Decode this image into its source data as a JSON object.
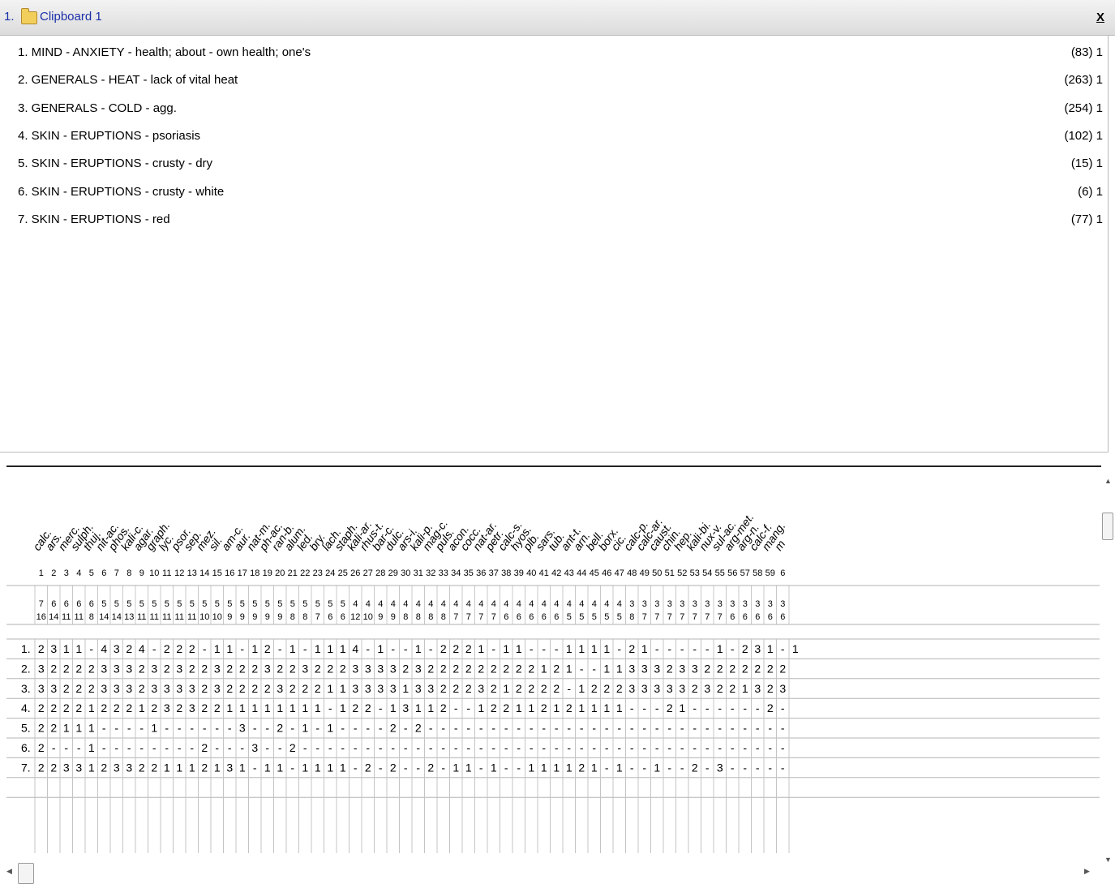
{
  "window": {
    "tab_number": "1.",
    "title": "Clipboard 1",
    "close_label": "X"
  },
  "rubrics": [
    {
      "label": "1. MIND - ANXIETY - health; about - own health; one's",
      "count": "(83) 1"
    },
    {
      "label": "2. GENERALS - HEAT - lack of vital heat",
      "count": "(263) 1"
    },
    {
      "label": "3. GENERALS - COLD - agg.",
      "count": "(254) 1"
    },
    {
      "label": "4. SKIN - ERUPTIONS - psoriasis",
      "count": "(102) 1"
    },
    {
      "label": "5. SKIN - ERUPTIONS - crusty - dry",
      "count": "(15) 1"
    },
    {
      "label": "6. SKIN - ERUPTIONS - crusty - white",
      "count": "(6) 1"
    },
    {
      "label": "7. SKIN - ERUPTIONS - red",
      "count": "(77) 1"
    }
  ],
  "remedies": [
    "calc.",
    "ars.",
    "merc.",
    "sulph.",
    "thuj.",
    "nit-ac.",
    "phos.",
    "kali-c.",
    "agar.",
    "graph.",
    "lyc.",
    "psor.",
    "sep.",
    "mez.",
    "sil.",
    "am-c.",
    "aur.",
    "nat-m.",
    "ph-ac.",
    "ran-b.",
    "alum.",
    "led.",
    "bry.",
    "lach.",
    "staph.",
    "kali-ar.",
    "rhus-t.",
    "bar-c.",
    "dulc.",
    "ars-i.",
    "kali-p.",
    "mag-c.",
    "puls.",
    "acon.",
    "cocc.",
    "nat-ar.",
    "petr.",
    "calc-s.",
    "hyos.",
    "plb.",
    "sars.",
    "tub.",
    "ant-t.",
    "arn.",
    "bell.",
    "borx.",
    "cic.",
    "calc-p.",
    "calc-ar.",
    "caust.",
    "chin.",
    "hep.",
    "kali-bi.",
    "nux-v.",
    "sul-ac.",
    "arg-met.",
    "arg-n.",
    "calc-f.",
    "mang.",
    "m"
  ],
  "column_numbers": [
    "1",
    "2",
    "3",
    "4",
    "5",
    "6",
    "7",
    "8",
    "9",
    "10",
    "11",
    "12",
    "13",
    "14",
    "15",
    "16",
    "17",
    "18",
    "19",
    "20",
    "21",
    "22",
    "23",
    "24",
    "25",
    "26",
    "27",
    "28",
    "29",
    "30",
    "31",
    "32",
    "33",
    "34",
    "35",
    "36",
    "37",
    "38",
    "39",
    "40",
    "41",
    "42",
    "43",
    "44",
    "45",
    "46",
    "47",
    "48",
    "49",
    "50",
    "51",
    "52",
    "53",
    "54",
    "55",
    "56",
    "57",
    "58",
    "59",
    "6"
  ],
  "symptom_counts": [
    "7",
    "6",
    "6",
    "6",
    "6",
    "5",
    "5",
    "5",
    "5",
    "5",
    "5",
    "5",
    "5",
    "5",
    "5",
    "5",
    "5",
    "5",
    "5",
    "5",
    "5",
    "5",
    "5",
    "5",
    "5",
    "4",
    "4",
    "4",
    "4",
    "4",
    "4",
    "4",
    "4",
    "4",
    "4",
    "4",
    "4",
    "4",
    "4",
    "4",
    "4",
    "4",
    "4",
    "4",
    "4",
    "4",
    "4",
    "3",
    "3",
    "3",
    "3",
    "3",
    "3",
    "3",
    "3",
    "3",
    "3",
    "3",
    "3",
    "3"
  ],
  "degree_totals": [
    "16",
    "14",
    "11",
    "11",
    "8",
    "14",
    "14",
    "13",
    "11",
    "11",
    "11",
    "11",
    "11",
    "10",
    "10",
    "9",
    "9",
    "9",
    "9",
    "9",
    "8",
    "8",
    "7",
    "6",
    "6",
    "12",
    "10",
    "9",
    "9",
    "8",
    "8",
    "8",
    "8",
    "7",
    "7",
    "7",
    "7",
    "6",
    "6",
    "6",
    "6",
    "6",
    "5",
    "5",
    "5",
    "5",
    "5",
    "8",
    "7",
    "7",
    "7",
    "7",
    "7",
    "7",
    "7",
    "6",
    "6",
    "6",
    "6",
    "6"
  ],
  "grid_rows": [
    {
      "label": "1.",
      "cells": [
        "2",
        "3",
        "1",
        "1",
        "-",
        "4",
        "3",
        "2",
        "4",
        "-",
        "2",
        "2",
        "2",
        "-",
        "1",
        "1",
        "-",
        "1",
        "2",
        "-",
        "1",
        "-",
        "1",
        "1",
        "1",
        "4",
        "-",
        "1",
        "-",
        "-",
        "1",
        "-",
        "2",
        "2",
        "2",
        "1",
        "-",
        "1",
        "1",
        "-",
        "-",
        "-",
        "1",
        "1",
        "1",
        "1",
        "-",
        "2",
        "1",
        "-",
        "-",
        "-",
        "-",
        "-",
        "1",
        "-",
        "2",
        "3",
        "1",
        "-",
        "1"
      ]
    },
    {
      "label": "2.",
      "cells": [
        "3",
        "2",
        "2",
        "2",
        "2",
        "3",
        "3",
        "3",
        "2",
        "3",
        "2",
        "3",
        "2",
        "2",
        "3",
        "2",
        "2",
        "2",
        "3",
        "2",
        "2",
        "3",
        "2",
        "2",
        "2",
        "3",
        "3",
        "3",
        "3",
        "2",
        "3",
        "2",
        "2",
        "2",
        "2",
        "2",
        "2",
        "2",
        "2",
        "2",
        "1",
        "2",
        "1",
        "-",
        "-",
        "1",
        "1",
        "3",
        "3",
        "3",
        "2",
        "3",
        "3",
        "2",
        "2",
        "2",
        "2",
        "2",
        "2",
        "2"
      ]
    },
    {
      "label": "3.",
      "cells": [
        "3",
        "3",
        "2",
        "2",
        "2",
        "3",
        "3",
        "3",
        "2",
        "3",
        "3",
        "3",
        "3",
        "2",
        "3",
        "2",
        "2",
        "2",
        "2",
        "3",
        "2",
        "2",
        "2",
        "1",
        "1",
        "3",
        "3",
        "3",
        "3",
        "1",
        "3",
        "3",
        "2",
        "2",
        "2",
        "3",
        "2",
        "1",
        "2",
        "2",
        "2",
        "2",
        "-",
        "1",
        "2",
        "2",
        "2",
        "3",
        "3",
        "3",
        "3",
        "3",
        "2",
        "3",
        "2",
        "2",
        "1",
        "3",
        "2",
        "3"
      ]
    },
    {
      "label": "4.",
      "cells": [
        "2",
        "2",
        "2",
        "2",
        "1",
        "2",
        "2",
        "2",
        "1",
        "2",
        "3",
        "2",
        "3",
        "2",
        "2",
        "1",
        "1",
        "1",
        "1",
        "1",
        "1",
        "1",
        "1",
        "-",
        "1",
        "2",
        "2",
        "-",
        "1",
        "3",
        "1",
        "1",
        "2",
        "-",
        "-",
        "1",
        "2",
        "2",
        "1",
        "1",
        "2",
        "1",
        "2",
        "1",
        "1",
        "1",
        "1",
        "-",
        "-",
        "-",
        "2",
        "1",
        "-",
        "-",
        "-",
        "-",
        "-",
        "-",
        "2",
        "-"
      ]
    },
    {
      "label": "5.",
      "cells": [
        "2",
        "2",
        "1",
        "1",
        "1",
        "-",
        "-",
        "-",
        "-",
        "1",
        "-",
        "-",
        "-",
        "-",
        "-",
        "-",
        "3",
        "-",
        "-",
        "2",
        "-",
        "1",
        "-",
        "1",
        "-",
        "-",
        "-",
        "-",
        "2",
        "-",
        "2",
        "-",
        "-",
        "-",
        "-",
        "-",
        "-",
        "-",
        "-",
        "-",
        "-",
        "-",
        "-",
        "-",
        "-",
        "-",
        "-",
        "-",
        "-",
        "-",
        "-",
        "-",
        "-",
        "-",
        "-",
        "-",
        "-",
        "-",
        "-",
        "-"
      ]
    },
    {
      "label": "6.",
      "cells": [
        "2",
        "-",
        "-",
        "-",
        "1",
        "-",
        "-",
        "-",
        "-",
        "-",
        "-",
        "-",
        "-",
        "2",
        "-",
        "-",
        "-",
        "3",
        "-",
        "-",
        "2",
        "-",
        "-",
        "-",
        "-",
        "-",
        "-",
        "-",
        "-",
        "-",
        "-",
        "-",
        "-",
        "-",
        "-",
        "-",
        "-",
        "-",
        "-",
        "-",
        "-",
        "-",
        "-",
        "-",
        "-",
        "-",
        "-",
        "-",
        "-",
        "-",
        "-",
        "-",
        "-",
        "-",
        "-",
        "-",
        "-",
        "-",
        "-",
        "-"
      ]
    },
    {
      "label": "7.",
      "cells": [
        "2",
        "2",
        "3",
        "3",
        "1",
        "2",
        "3",
        "3",
        "2",
        "2",
        "1",
        "1",
        "1",
        "2",
        "1",
        "3",
        "1",
        "-",
        "1",
        "1",
        "-",
        "1",
        "1",
        "1",
        "1",
        "-",
        "2",
        "-",
        "2",
        "-",
        "-",
        "2",
        "-",
        "1",
        "1",
        "-",
        "1",
        "-",
        "-",
        "1",
        "1",
        "1",
        "1",
        "2",
        "1",
        "-",
        "1",
        "-",
        "-",
        "1",
        "-",
        "-",
        "2",
        "-",
        "3",
        "-",
        "-",
        "-",
        "-",
        "-"
      ]
    }
  ]
}
